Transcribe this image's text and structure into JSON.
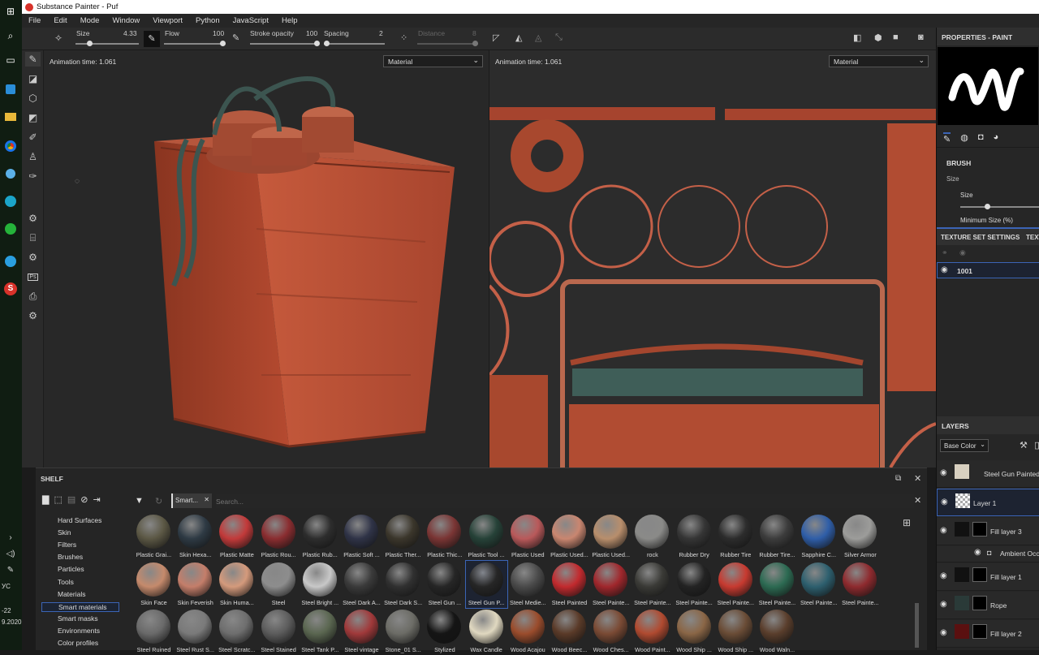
{
  "app": {
    "title": "Substance Painter - Puf",
    "menu": [
      "File",
      "Edit",
      "Mode",
      "Window",
      "Viewport",
      "Python",
      "JavaScript",
      "Help"
    ]
  },
  "toolbar": {
    "size_label": "Size",
    "size_value": "4.33",
    "flow_label": "Flow",
    "flow_value": "100",
    "stroke_label": "Stroke opacity",
    "stroke_value": "100",
    "spacing_label": "Spacing",
    "spacing_value": "2",
    "distance_label": "Distance",
    "distance_value": "8"
  },
  "viewport3d": {
    "anim_time": "Animation time: 1.061",
    "channel": "Material"
  },
  "viewport2d": {
    "anim_time": "Animation time: 1.061",
    "channel": "Material"
  },
  "taskbar": {
    "clock_time": "-22",
    "clock_date": "9.2020",
    "lang": "УС"
  },
  "shelf": {
    "title": "SHELF",
    "filter_tag": "Smart...",
    "search_placeholder": "Search...",
    "categories": [
      "Hard Surfaces",
      "Skin",
      "Filters",
      "Brushes",
      "Particles",
      "Tools",
      "Materials",
      "Smart materials",
      "Smart masks",
      "Environments",
      "Color profiles"
    ],
    "selected_category": "Smart materials",
    "materials": [
      [
        {
          "label": "Plastic Grai...",
          "color": "#5b5744"
        },
        {
          "label": "Skin Hexa...",
          "color": "#2e3a44"
        },
        {
          "label": "Plastic Matte",
          "color": "#c23a3a"
        },
        {
          "label": "Plastic Rou...",
          "color": "#8a2d30"
        },
        {
          "label": "Plastic Rub...",
          "color": "#2d2d2d"
        },
        {
          "label": "Plastic Soft ...",
          "color": "#2f3347"
        },
        {
          "label": "Plastic Ther...",
          "color": "#3b362b"
        },
        {
          "label": "Plastic Thic...",
          "color": "#7a3534"
        },
        {
          "label": "Plastic Tool ...",
          "color": "#264238"
        },
        {
          "label": "Plastic Used",
          "color": "#b9595a"
        },
        {
          "label": "Plastic Used...",
          "color": "#c98670"
        },
        {
          "label": "Plastic Used...",
          "color": "#b88e6c"
        },
        {
          "label": "rock",
          "color": "#8a8a88"
        },
        {
          "label": "Rubber Dry",
          "color": "#353535"
        },
        {
          "label": "Rubber Tire",
          "color": "#2c2c2c"
        },
        {
          "label": "Rubber Tire...",
          "color": "#3c3c3c"
        },
        {
          "label": "Sapphire C...",
          "color": "#2f5ea8"
        },
        {
          "label": "Silver Armor",
          "color": "#9c9c9a"
        }
      ],
      [
        {
          "label": "Skin Face",
          "color": "#c58a6c"
        },
        {
          "label": "Skin Feverish",
          "color": "#c47e6a"
        },
        {
          "label": "Skin Huma...",
          "color": "#d49a7c"
        },
        {
          "label": "Steel",
          "color": "#8d8d8d"
        },
        {
          "label": "Steel Bright ...",
          "color": "#c8c8c8"
        },
        {
          "label": "Steel Dark A...",
          "color": "#3a3a3a"
        },
        {
          "label": "Steel Dark S...",
          "color": "#303030"
        },
        {
          "label": "Steel Gun ...",
          "color": "#262626"
        },
        {
          "label": "Steel Gun P...",
          "color": "#262626",
          "selected": true
        },
        {
          "label": "Steel Medie...",
          "color": "#4a4a4a"
        },
        {
          "label": "Steel Painted",
          "color": "#c22a2e"
        },
        {
          "label": "Steel Painte...",
          "color": "#a0272c"
        },
        {
          "label": "Steel Painte...",
          "color": "#3a3a36"
        },
        {
          "label": "Steel Painte...",
          "color": "#232323"
        },
        {
          "label": "Steel Painte...",
          "color": "#c73a30"
        },
        {
          "label": "Steel Painte...",
          "color": "#2c6a52"
        },
        {
          "label": "Steel Painte...",
          "color": "#2d5f6e"
        },
        {
          "label": "Steel Painte...",
          "color": "#8e2a2e"
        }
      ],
      [
        {
          "label": "Steel Ruined",
          "color": "#6a6a6a"
        },
        {
          "label": "Steel Rust S...",
          "color": "#7a7a7a"
        },
        {
          "label": "Steel Scratc...",
          "color": "#6e6e6e"
        },
        {
          "label": "Steel Stained",
          "color": "#5c5c5c"
        },
        {
          "label": "Steel Tank P...",
          "color": "#5a6650"
        },
        {
          "label": "Steel vintage",
          "color": "#a0393a"
        },
        {
          "label": "Stone_01 S...",
          "color": "#6c6c66"
        },
        {
          "label": "Stylized",
          "color": "#151515"
        },
        {
          "label": "Wax Candle",
          "color": "#e0d8c0"
        },
        {
          "label": "Wood Acajou",
          "color": "#9a4c2c"
        },
        {
          "label": "Wood Beec...",
          "color": "#5a3a28"
        },
        {
          "label": "Wood Ches...",
          "color": "#7a4a34"
        },
        {
          "label": "Wood Paint...",
          "color": "#b04a30"
        },
        {
          "label": "Wood Ship ...",
          "color": "#8a6646"
        },
        {
          "label": "Wood Ship ...",
          "color": "#6a4c36"
        },
        {
          "label": "Wood Waln...",
          "color": "#5a3e2c"
        }
      ]
    ]
  },
  "properties": {
    "title": "PROPERTIES - PAINT",
    "brush_section": "BRUSH",
    "size_label": "Size",
    "size_sub_label": "Size",
    "min_size_label": "Minimum Size (%)"
  },
  "texture_set": {
    "tab1": "TEXTURE SET SETTINGS",
    "tab2": "TEXT",
    "item": "1001"
  },
  "layers": {
    "title": "LAYERS",
    "channel": "Base Color",
    "items": [
      {
        "name": "Steel Gun Painted",
        "type": "folder"
      },
      {
        "name": "Layer 1",
        "type": "paint",
        "selected": true
      },
      {
        "name": "Fill layer 3",
        "type": "fill"
      },
      {
        "name": "Ambient Occlu",
        "type": "effect"
      },
      {
        "name": "Fill layer 1",
        "type": "fill"
      },
      {
        "name": "Rope",
        "type": "fill"
      },
      {
        "name": "Fill layer 2",
        "type": "fill"
      }
    ]
  },
  "colors": {
    "accent": "#3b64b6",
    "rust": "#a8452e",
    "panel": "#262626"
  }
}
